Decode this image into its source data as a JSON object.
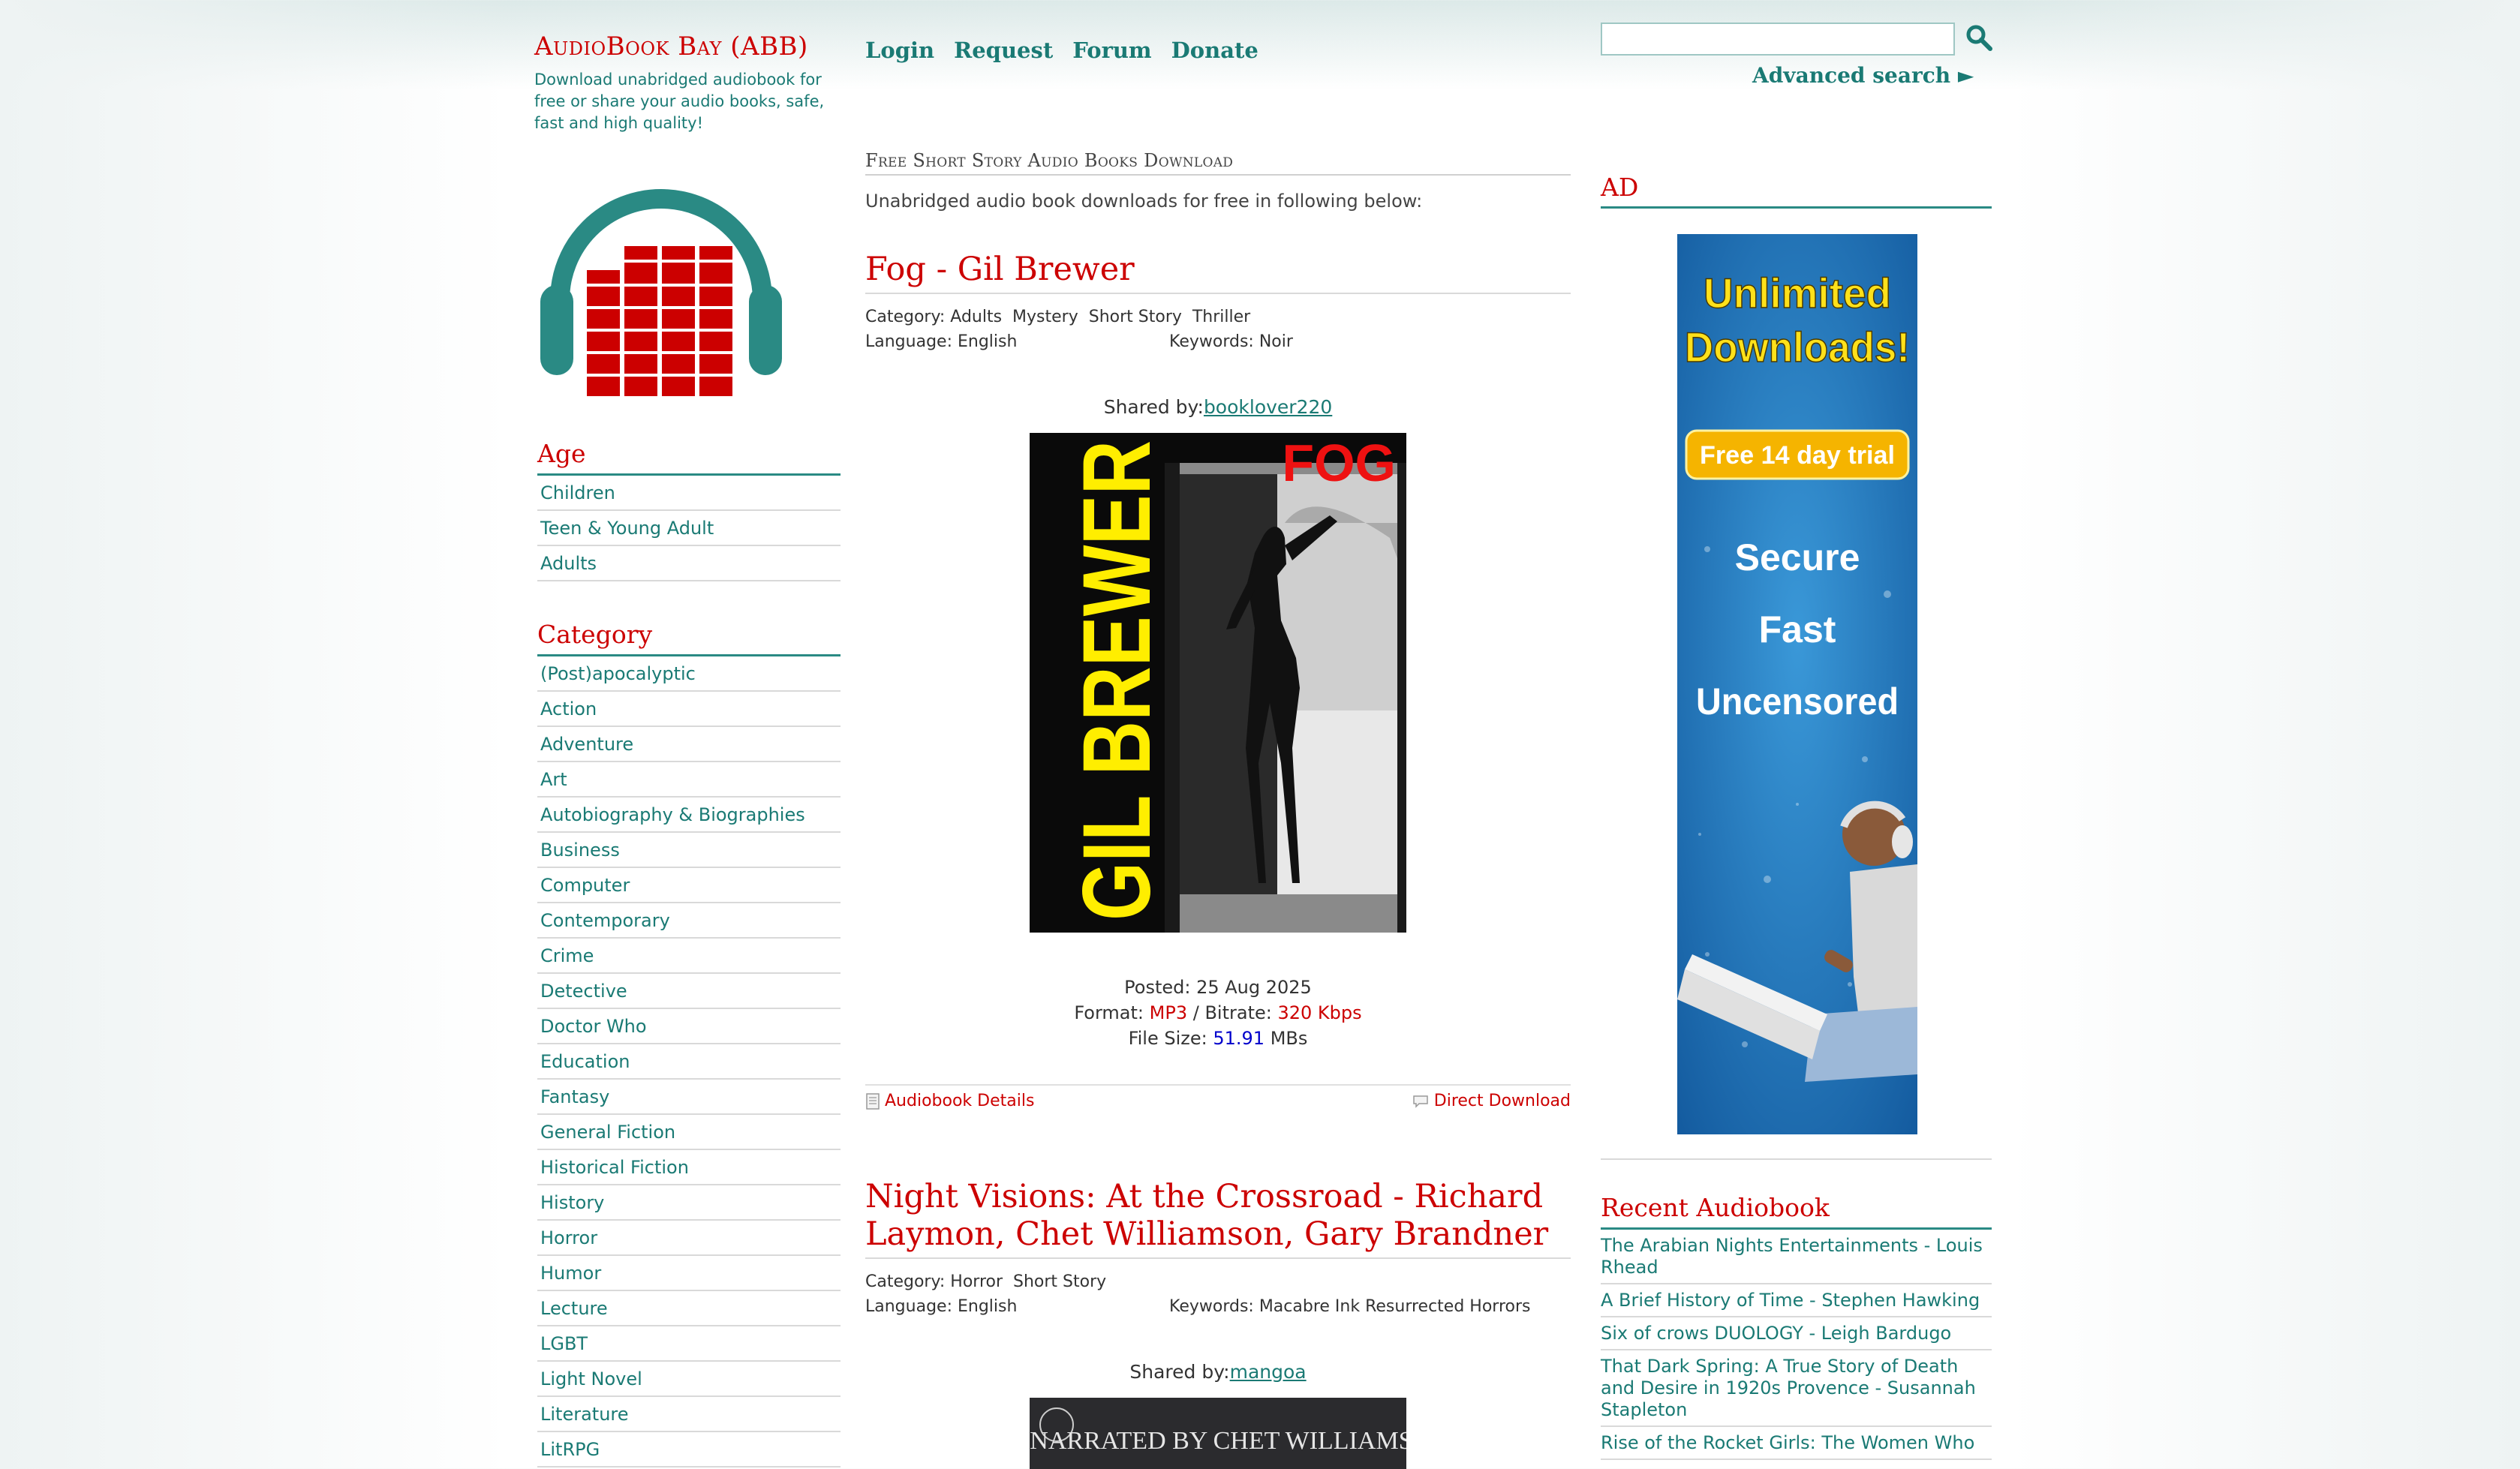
{
  "header": {
    "site_title": "AudioBook Bay (ABB)",
    "tagline": "Download unabridged audiobook for free or share your audio books, safe, fast and high quality!",
    "nav": [
      "Login",
      "Request",
      "Forum",
      "Donate"
    ],
    "search_value": "",
    "advanced_search": "Advanced search ►"
  },
  "sidebar": {
    "age_heading": "Age",
    "age_items": [
      "Children",
      "Teen & Young Adult",
      "Adults"
    ],
    "category_heading": "Category",
    "category_items": [
      "(Post)apocalyptic",
      "Action",
      "Adventure",
      "Art",
      "Autobiography & Biographies",
      "Business",
      "Computer",
      "Contemporary",
      "Crime",
      "Detective",
      "Doctor Who",
      "Education",
      "Fantasy",
      "General Fiction",
      "Historical Fiction",
      "History",
      "Horror",
      "Humor",
      "Lecture",
      "LGBT",
      "Light Novel",
      "Literature",
      "LitRPG"
    ]
  },
  "main": {
    "section_title": "Free Short Story Audio Books Download",
    "intro": "Unabridged audio book downloads for free in following below:",
    "posts": [
      {
        "title": "Fog - Gil Brewer",
        "category": "Category: Adults  Mystery  Short Story  Thriller",
        "language": "Language: English",
        "keywords": "Keywords: Noir",
        "shared_label": "Shared by:",
        "shared_by": "booklover220",
        "cover_author": "GIL BREWER",
        "cover_title": "FOG",
        "posted": "Posted: 25 Aug 2025",
        "format_label": "Format:",
        "format": "MP3",
        "bitrate_label": "/ Bitrate:",
        "bitrate": "320 Kbps",
        "filesize_label": "File Size:",
        "filesize": "51.91",
        "filesize_unit": "MBs",
        "details_link": "Audiobook Details",
        "download_link": "Direct Download"
      },
      {
        "title": "Night Visions: At the Crossroad - Richard Laymon, Chet Williamson, Gary Brandner",
        "category": "Category: Horror  Short Story",
        "language": "Language: English",
        "keywords": "Keywords: Macabre Ink Resurrected Horrors",
        "shared_label": "Shared by:",
        "shared_by": "mangoa",
        "cover_text": "NARRATED BY CHET WILLIAMSON"
      }
    ]
  },
  "right": {
    "ad_heading": "AD",
    "ad": {
      "headline": "Unlimited Downloads!",
      "trial": "Free 14 day trial",
      "features": [
        "Secure",
        "Fast",
        "Uncensored"
      ]
    },
    "recent_heading": "Recent Audiobook",
    "recent_items": [
      "The Arabian Nights Entertainments - Louis Rhead",
      "A Brief History of Time - Stephen Hawking",
      "Six of crows DUOLOGY - Leigh Bardugo",
      "That Dark Spring: A True Story of Death and Desire in 1920s Provence - Susannah Stapleton",
      "Rise of the Rocket Girls: The Women Who"
    ]
  },
  "colors": {
    "brand_red": "#cc0000",
    "teal": "#1a7a74",
    "ad_blue": "#1c6fb4",
    "ad_yellow": "#ffe11a"
  }
}
